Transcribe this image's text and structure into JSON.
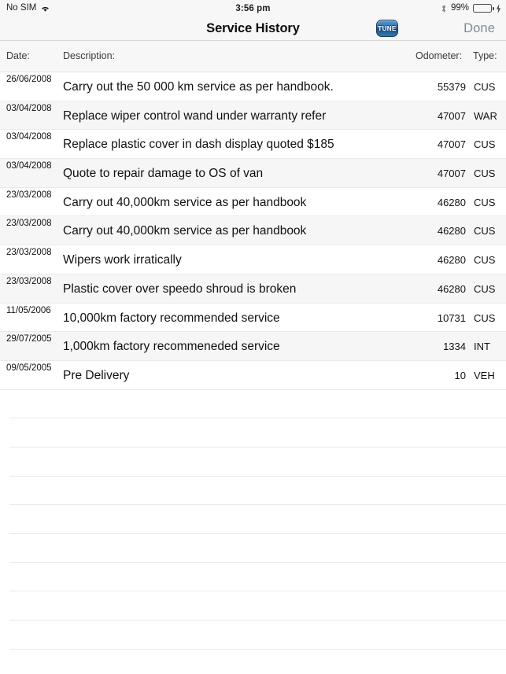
{
  "status_bar": {
    "carrier": "No SIM",
    "wifi_icon": "wifi-icon",
    "time": "3:56 pm",
    "bluetooth_icon": "bluetooth-icon",
    "battery_percent": "99%",
    "battery_level": 99,
    "battery_icon": "battery-icon",
    "charging_icon": "lightning-bolt-icon",
    "background_color": "#f7f7f7"
  },
  "nav_bar": {
    "title": "Service History",
    "badge_label": "TUNE",
    "badge_icon": "tune-badge-icon",
    "done_label": "Done",
    "done_color": "#7e8b9c",
    "background_color": "#f7f7f7"
  },
  "table": {
    "headers": {
      "date": "Date:",
      "description": "Description:",
      "odometer": "Odometer:",
      "type": "Type:"
    },
    "rows": [
      {
        "date": "26/06/2008",
        "description": "Carry out the 50 000 km service as per handbook.",
        "odometer": "55379",
        "type": "CUS"
      },
      {
        "date": "03/04/2008",
        "description": "Replace wiper control wand under warranty refer",
        "odometer": "47007",
        "type": "WAR"
      },
      {
        "date": "03/04/2008",
        "description": "Replace plastic cover in dash display quoted $185",
        "odometer": "47007",
        "type": "CUS"
      },
      {
        "date": "03/04/2008",
        "description": "Quote to repair damage to OS of van",
        "odometer": "47007",
        "type": "CUS"
      },
      {
        "date": "23/03/2008",
        "description": "Carry out 40,000km service as per handbook",
        "odometer": "46280",
        "type": "CUS"
      },
      {
        "date": "23/03/2008",
        "description": "Carry out 40,000km service as per handbook",
        "odometer": "46280",
        "type": "CUS"
      },
      {
        "date": "23/03/2008",
        "description": "Wipers work irratically",
        "odometer": "46280",
        "type": "CUS"
      },
      {
        "date": "23/03/2008",
        "description": "Plastic cover over speedo shroud is broken",
        "odometer": "46280",
        "type": "CUS"
      },
      {
        "date": "11/05/2006",
        "description": "10,000km factory recommended service",
        "odometer": "10731",
        "type": "CUS"
      },
      {
        "date": "29/07/2005",
        "description": "1,000km factory recommeneded service",
        "odometer": "1334",
        "type": "INT"
      },
      {
        "date": "09/05/2005",
        "description": "Pre Delivery",
        "odometer": "10",
        "type": "VEH"
      }
    ],
    "empty_row_count": 10,
    "row_background": "#ffffff",
    "alt_row_background": "#f6f6f7",
    "separator_color": "#eaeaec"
  }
}
